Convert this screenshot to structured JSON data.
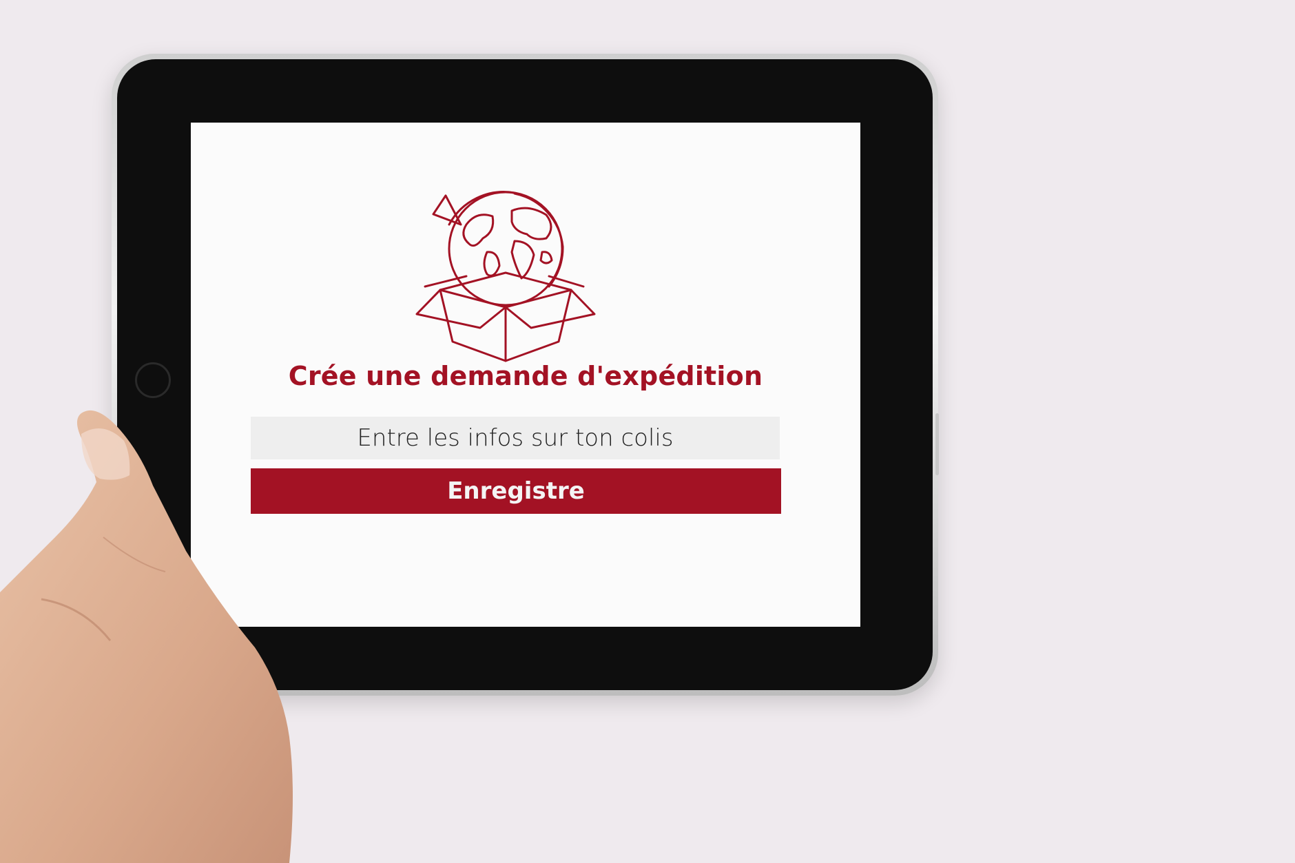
{
  "screen": {
    "title": "Crée une demande d'expédition",
    "info_field_text": "Entre les infos sur ton colis",
    "save_label": "Enregistre"
  },
  "icons": {
    "logo": "globe-in-box-icon",
    "home_button": "home-button-icon"
  },
  "colors": {
    "accent": "#a31224",
    "background": "#efeaee",
    "screen": "#fbfbfb",
    "field": "#eeeeee"
  }
}
